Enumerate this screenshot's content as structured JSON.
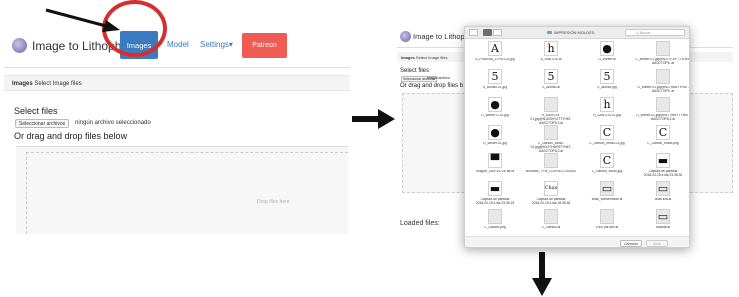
{
  "left_panel": {
    "app_title": "Image to Lithophane",
    "nav": {
      "images": "Images",
      "model": "Model",
      "settings": "Settings▾",
      "patreon": "Patreon"
    },
    "breadcrumb": {
      "bold": "Images",
      "rest": " Select Image files"
    },
    "select_files": "Select files",
    "choose_button": "Seleccionar archivos",
    "no_file": "ningún archivo seleccionado",
    "drag_drop": "Or drag and drop files below",
    "drop_hint": "Drop files here"
  },
  "right_panel": {
    "app_title": "Image to Lithophane",
    "breadcrumb": {
      "bold": "Images",
      "rest": " Select Image files"
    },
    "select_files": "Select files",
    "choose_button": "Seleccionar archivos",
    "no_file": "ningún archivo",
    "drag_drop": "Or drag and drop files b",
    "loaded_files": "Loaded files:"
  },
  "dialog": {
    "folder": "IMPRESIÓN MOLDES",
    "search_placeholder": "Q  Buscar",
    "cancel": "Cancelar",
    "open": "Abrir",
    "files": [
      {
        "name": "A_PRUEBA_LITHO-01.jpg",
        "glyph": "A",
        "kind": "doc"
      },
      {
        "name": "A_SANTOS.ai",
        "glyph": "h",
        "kind": "doc"
      },
      {
        "name": "O_Winter.ai",
        "glyph": "●",
        "kind": "doc"
      },
      {
        "name": "C_Winter-01.jpg@N1TIY-EFTTYH6T-AASCTOP5-.ai",
        "glyph": "",
        "kind": "light"
      },
      {
        "name": "S_Alonso-01.jpg",
        "glyph": "5",
        "kind": "doc"
      },
      {
        "name": "S_Alonso.ai",
        "glyph": "5",
        "kind": "doc"
      },
      {
        "name": "S_Alonso.jpg",
        "glyph": "5",
        "kind": "doc"
      },
      {
        "name": "O_Winter-01.jpg@N1TH8BTYH6T-AASCTOP5-.ai",
        "glyph": "",
        "kind": "light"
      },
      {
        "name": "O_Winter-O-01.jpg",
        "glyph": "●",
        "kind": "doc"
      },
      {
        "name": "H_SANTOS-01.jpg@N1GSHYZTTYH6T-AASCTOP5-2.ai",
        "glyph": "",
        "kind": "light"
      },
      {
        "name": "H_SANTOS-01.jpg",
        "glyph": "h",
        "kind": "doc"
      },
      {
        "name": "O_Winter-01.jpg@N1TVHBTTYH6T-AASCTOP5-2.ai",
        "glyph": "",
        "kind": "light"
      },
      {
        "name": "O_Winter-01.jpg",
        "glyph": "●",
        "kind": "doc"
      },
      {
        "name": "C_Garson_fondo-01.jpg@N12YH6ERTYH6T-AASCTOP5-2.ai",
        "glyph": "",
        "kind": "light"
      },
      {
        "name": "C_Garson_fondo-01.jpg",
        "glyph": "C",
        "kind": "doc"
      },
      {
        "name": "C_Garson_fondo.png",
        "glyph": "C",
        "kind": "doc"
      },
      {
        "name": "Snippet_310F3472E.tiff.ra",
        "glyph": "▀",
        "kind": "doc"
      },
      {
        "name": "Borrador_TFM_CORRECCIONES",
        "glyph": "",
        "kind": "light"
      },
      {
        "name": "C_Garson_fondo.jpg",
        "glyph": "C",
        "kind": "doc"
      },
      {
        "name": "Captura de pantalla\n2018-04-15 a las 23.36.32",
        "glyph": "▬",
        "kind": "doc"
      },
      {
        "name": "Captura de pantalla\n2018-04-15 a las 23.36.24",
        "glyph": "▬",
        "kind": "doc"
      },
      {
        "name": "Captura de pantalla\n2018-04-15 a las 18.36.46",
        "glyph": "Chas",
        "kind": "doc"
      },
      {
        "name": "chas_Windermilde.ai",
        "glyph": "▭",
        "kind": "light"
      },
      {
        "name": "chas.liza.ai",
        "glyph": "▭",
        "kind": "light"
      },
      {
        "name": "C_Garson.png",
        "glyph": "",
        "kind": "light"
      },
      {
        "name": "C_Garson.ai",
        "glyph": "",
        "kind": "light"
      },
      {
        "name": "1000 pts anti.ai",
        "glyph": "",
        "kind": "light"
      },
      {
        "name": "chasas.ai",
        "glyph": "▭",
        "kind": "light"
      }
    ]
  }
}
